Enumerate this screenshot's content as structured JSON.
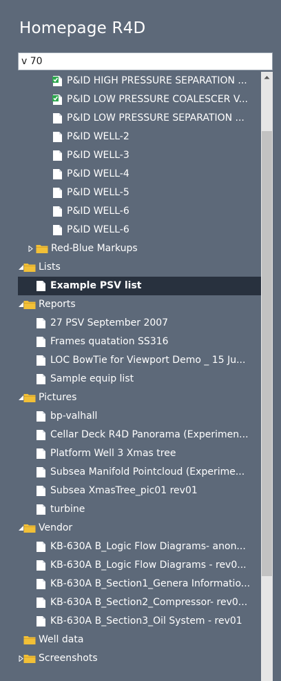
{
  "header": {
    "title": "Homepage R4D"
  },
  "search": {
    "value": "v 70"
  },
  "tree": [
    {
      "label": "P&ID HIGH PRESSURE SEPARATION ...",
      "icon": "checked-doc",
      "level": 2
    },
    {
      "label": "P&ID LOW PRESSURE COALESCER V...",
      "icon": "checked-doc",
      "level": 2
    },
    {
      "label": "P&ID LOW PRESSURE SEPARATION ...",
      "icon": "doc",
      "level": 2
    },
    {
      "label": "P&ID WELL-2",
      "icon": "doc",
      "level": 2
    },
    {
      "label": "P&ID WELL-3",
      "icon": "doc",
      "level": 2
    },
    {
      "label": "P&ID WELL-4",
      "icon": "doc",
      "level": 2
    },
    {
      "label": "P&ID WELL-5",
      "icon": "doc",
      "level": 2
    },
    {
      "label": "P&ID WELL-6",
      "icon": "doc",
      "level": 2
    },
    {
      "label": "P&ID WELL-6",
      "icon": "doc",
      "level": 2
    },
    {
      "label": "Red-Blue Markups",
      "icon": "folder",
      "level": 1,
      "expander": "collapsed"
    },
    {
      "label": "Lists",
      "icon": "folder",
      "level": 0,
      "expander": "expanded"
    },
    {
      "label": "Example PSV list",
      "icon": "doc",
      "level": 1,
      "selected": true
    },
    {
      "label": "Reports",
      "icon": "folder",
      "level": 0,
      "expander": "expanded"
    },
    {
      "label": "27 PSV September 2007",
      "icon": "doc",
      "level": 1
    },
    {
      "label": "Frames quatation SS316",
      "icon": "doc",
      "level": 1
    },
    {
      "label": "LOC BowTie for Viewport Demo _ 15 Ju...",
      "icon": "doc",
      "level": 1
    },
    {
      "label": "Sample equip list",
      "icon": "doc",
      "level": 1
    },
    {
      "label": "Pictures",
      "icon": "folder",
      "level": 0,
      "expander": "expanded"
    },
    {
      "label": "bp-valhall",
      "icon": "doc",
      "level": 1
    },
    {
      "label": "Cellar Deck R4D Panorama (Experimen...",
      "icon": "doc",
      "level": 1
    },
    {
      "label": "Platform Well 3 Xmas tree",
      "icon": "doc",
      "level": 1
    },
    {
      "label": "Subsea Manifold Pointcloud (Experime...",
      "icon": "doc",
      "level": 1
    },
    {
      "label": "Subsea XmasTree_pic01 rev01",
      "icon": "doc",
      "level": 1
    },
    {
      "label": "turbine",
      "icon": "doc",
      "level": 1
    },
    {
      "label": "Vendor",
      "icon": "folder",
      "level": 0,
      "expander": "expanded"
    },
    {
      "label": "KB-630A B_Logic Flow Diagrams- anon...",
      "icon": "doc",
      "level": 1
    },
    {
      "label": "KB-630A B_Logic Flow Diagrams - rev0...",
      "icon": "doc",
      "level": 1
    },
    {
      "label": "KB-630A B_Section1_Genera Informatio...",
      "icon": "doc",
      "level": 1
    },
    {
      "label": "KB-630A B_Section2_Compressor- rev0...",
      "icon": "doc",
      "level": 1
    },
    {
      "label": "KB-630A B_Section3_Oil System - rev01",
      "icon": "doc",
      "level": 1
    },
    {
      "label": "Well data",
      "icon": "folder",
      "level": 0
    },
    {
      "label": "Screenshots",
      "icon": "folder",
      "level": 0,
      "expander": "collapsed"
    }
  ],
  "scroll": {
    "position_fraction": 0.31,
    "visible_fraction": 0.73
  },
  "colors": {
    "panel_bg": "#5d6979",
    "selected_bg": "#28313e",
    "folder": "#f2c037",
    "check": "#2fa84f",
    "text": "#ffffff"
  }
}
